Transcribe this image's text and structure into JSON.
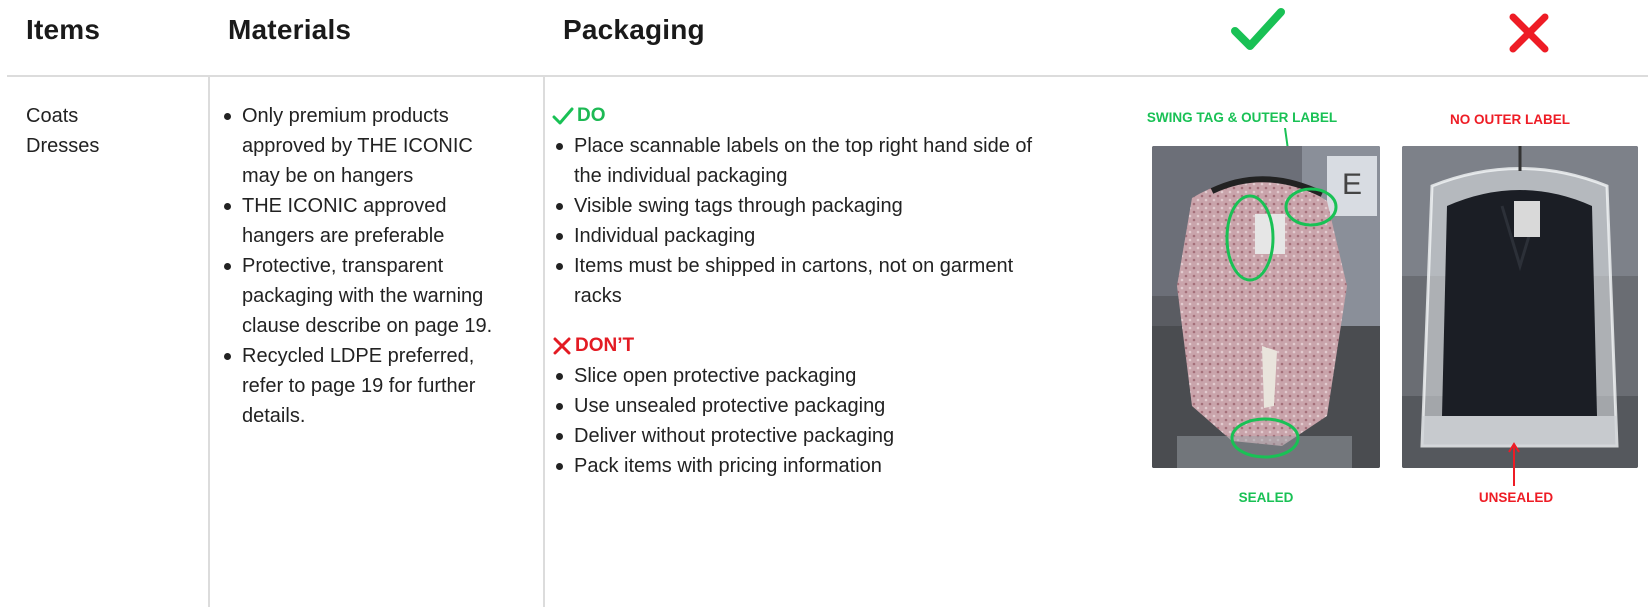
{
  "headers": {
    "items": "Items",
    "materials": "Materials",
    "packaging": "Packaging"
  },
  "header_icons": {
    "do": "checkmark-icon",
    "dont": "cross-icon"
  },
  "colors": {
    "green": "#19c155",
    "red": "#ee1c25",
    "divider": "#dcdcdc"
  },
  "items": [
    "Coats",
    "Dresses"
  ],
  "materials": [
    "Only premium products approved by THE ICONIC may be on hangers",
    "THE ICONIC approved hangers are preferable",
    "Protective, transparent packaging with the warning clause describe on page 19.",
    "Recycled LDPE preferred, refer to page 19 for further details."
  ],
  "packaging": {
    "do_label": "DO",
    "do_items": [
      "Place scannable labels on the top right hand side of the individual packaging",
      "Visible swing tags through packaging",
      "Individual packaging",
      "Items must be shipped in cartons, not on garment racks"
    ],
    "dont_label": "DON’T",
    "dont_items": [
      "Slice open protective packaging",
      "Use unsealed protective packaging",
      "Deliver without protective packaging",
      "Pack items with pricing information"
    ]
  },
  "photos": {
    "good": {
      "top_label": "SWING TAG & OUTER LABEL",
      "bottom_label": "SEALED"
    },
    "bad": {
      "top_label": "NO OUTER LABEL",
      "bottom_label": "UNSEALED"
    }
  }
}
